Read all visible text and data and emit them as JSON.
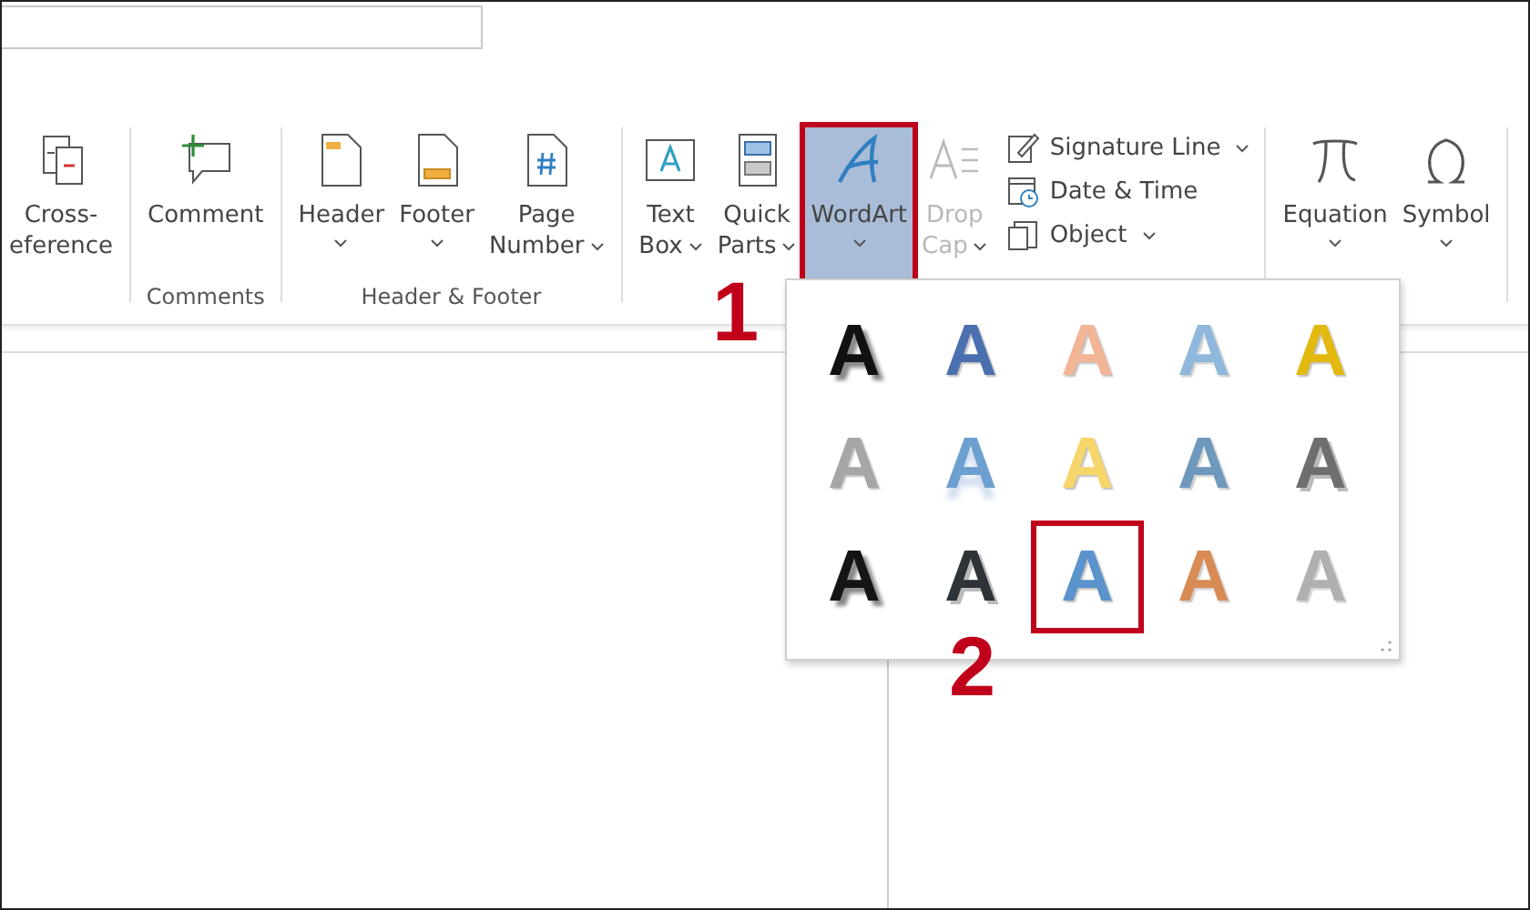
{
  "ribbon": {
    "groups": [
      {
        "buttons": [
          {
            "lines": [
              "Cross-",
              "eference"
            ],
            "dropdown": false,
            "disabled": false,
            "selected": false,
            "marked": false
          }
        ]
      },
      {
        "label": "Comments",
        "buttons": [
          {
            "lines": [
              "Comment"
            ],
            "dropdown": false,
            "disabled": false,
            "selected": false,
            "marked": false
          }
        ]
      },
      {
        "label": "Header & Footer",
        "buttons": [
          {
            "lines": [
              "Header"
            ],
            "dropdown": true,
            "disabled": false,
            "selected": false,
            "marked": false
          },
          {
            "lines": [
              "Footer"
            ],
            "dropdown": true,
            "disabled": false,
            "selected": false,
            "marked": false
          },
          {
            "lines": [
              "Page",
              "Number"
            ],
            "dropdown": true,
            "disabled": false,
            "selected": false,
            "marked": false
          }
        ]
      },
      {
        "buttons": [
          {
            "lines": [
              "Text",
              "Box"
            ],
            "dropdown": true,
            "disabled": false,
            "selected": false,
            "marked": false
          },
          {
            "lines": [
              "Quick",
              "Parts"
            ],
            "dropdown": true,
            "disabled": false,
            "selected": false,
            "marked": false
          },
          {
            "lines": [
              "WordArt"
            ],
            "dropdown": true,
            "disabled": false,
            "selected": true,
            "marked": true
          },
          {
            "lines": [
              "Drop",
              "Cap"
            ],
            "dropdown": true,
            "disabled": true,
            "selected": false,
            "marked": false
          }
        ],
        "small": [
          {
            "label": "Signature Line",
            "dropdown": true
          },
          {
            "label": "Date & Time",
            "dropdown": false
          },
          {
            "label": "Object",
            "dropdown": true
          }
        ]
      },
      {
        "buttons": [
          {
            "lines": [
              "Equation"
            ],
            "dropdown": true,
            "disabled": false,
            "selected": false,
            "marked": false
          },
          {
            "lines": [
              "Symbol"
            ],
            "dropdown": true,
            "disabled": false,
            "selected": false,
            "marked": false
          }
        ]
      }
    ]
  },
  "gallery": {
    "styles": [
      {
        "text": "A",
        "kind": "shadow",
        "color": "#111111",
        "marked": false
      },
      {
        "text": "A",
        "kind": "fill",
        "color": "#4a70b0",
        "marked": false
      },
      {
        "text": "A",
        "kind": "fill",
        "color": "#f2b595",
        "marked": false
      },
      {
        "text": "A",
        "kind": "outline",
        "color": "#8fb8dc",
        "marked": false
      },
      {
        "text": "A",
        "kind": "fill",
        "color": "#e3b910",
        "marked": false
      },
      {
        "text": "A",
        "kind": "fill",
        "color": "#a6a6a6",
        "marked": false
      },
      {
        "text": "A",
        "kind": "reflection",
        "color": "#6d9fd0",
        "marked": false
      },
      {
        "text": "A",
        "kind": "fill",
        "color": "#f6d66a",
        "marked": false
      },
      {
        "text": "A",
        "kind": "outline",
        "color": "#6f98bd",
        "marked": false
      },
      {
        "text": "A",
        "kind": "bevel",
        "color": "#6e6e6e",
        "marked": false
      },
      {
        "text": "A",
        "kind": "shadow",
        "color": "#151515",
        "marked": false
      },
      {
        "text": "A",
        "kind": "bevel",
        "color": "#2e3338",
        "marked": false
      },
      {
        "text": "A",
        "kind": "fill",
        "color": "#5b93cc",
        "marked": true
      },
      {
        "text": "A",
        "kind": "outline",
        "color": "#d98b55",
        "marked": false
      },
      {
        "text": "A",
        "kind": "outline",
        "color": "#b0b0b0",
        "marked": false
      }
    ]
  },
  "annotations": [
    {
      "label": "1"
    },
    {
      "label": "2"
    }
  ]
}
